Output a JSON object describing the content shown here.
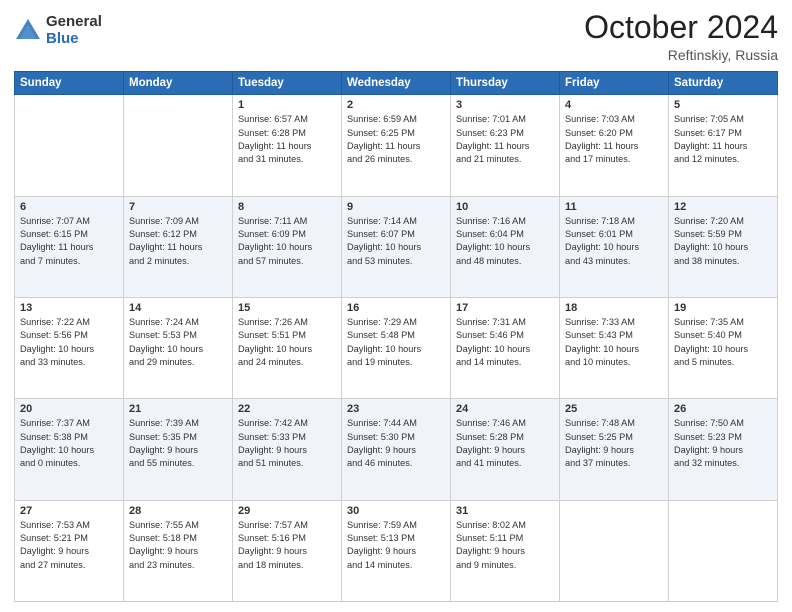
{
  "logo": {
    "general": "General",
    "blue": "Blue"
  },
  "header": {
    "month": "October 2024",
    "location": "Reftinskiy, Russia"
  },
  "days": [
    "Sunday",
    "Monday",
    "Tuesday",
    "Wednesday",
    "Thursday",
    "Friday",
    "Saturday"
  ],
  "rows": [
    [
      {
        "num": "",
        "lines": []
      },
      {
        "num": "",
        "lines": []
      },
      {
        "num": "1",
        "lines": [
          "Sunrise: 6:57 AM",
          "Sunset: 6:28 PM",
          "Daylight: 11 hours",
          "and 31 minutes."
        ]
      },
      {
        "num": "2",
        "lines": [
          "Sunrise: 6:59 AM",
          "Sunset: 6:25 PM",
          "Daylight: 11 hours",
          "and 26 minutes."
        ]
      },
      {
        "num": "3",
        "lines": [
          "Sunrise: 7:01 AM",
          "Sunset: 6:23 PM",
          "Daylight: 11 hours",
          "and 21 minutes."
        ]
      },
      {
        "num": "4",
        "lines": [
          "Sunrise: 7:03 AM",
          "Sunset: 6:20 PM",
          "Daylight: 11 hours",
          "and 17 minutes."
        ]
      },
      {
        "num": "5",
        "lines": [
          "Sunrise: 7:05 AM",
          "Sunset: 6:17 PM",
          "Daylight: 11 hours",
          "and 12 minutes."
        ]
      }
    ],
    [
      {
        "num": "6",
        "lines": [
          "Sunrise: 7:07 AM",
          "Sunset: 6:15 PM",
          "Daylight: 11 hours",
          "and 7 minutes."
        ]
      },
      {
        "num": "7",
        "lines": [
          "Sunrise: 7:09 AM",
          "Sunset: 6:12 PM",
          "Daylight: 11 hours",
          "and 2 minutes."
        ]
      },
      {
        "num": "8",
        "lines": [
          "Sunrise: 7:11 AM",
          "Sunset: 6:09 PM",
          "Daylight: 10 hours",
          "and 57 minutes."
        ]
      },
      {
        "num": "9",
        "lines": [
          "Sunrise: 7:14 AM",
          "Sunset: 6:07 PM",
          "Daylight: 10 hours",
          "and 53 minutes."
        ]
      },
      {
        "num": "10",
        "lines": [
          "Sunrise: 7:16 AM",
          "Sunset: 6:04 PM",
          "Daylight: 10 hours",
          "and 48 minutes."
        ]
      },
      {
        "num": "11",
        "lines": [
          "Sunrise: 7:18 AM",
          "Sunset: 6:01 PM",
          "Daylight: 10 hours",
          "and 43 minutes."
        ]
      },
      {
        "num": "12",
        "lines": [
          "Sunrise: 7:20 AM",
          "Sunset: 5:59 PM",
          "Daylight: 10 hours",
          "and 38 minutes."
        ]
      }
    ],
    [
      {
        "num": "13",
        "lines": [
          "Sunrise: 7:22 AM",
          "Sunset: 5:56 PM",
          "Daylight: 10 hours",
          "and 33 minutes."
        ]
      },
      {
        "num": "14",
        "lines": [
          "Sunrise: 7:24 AM",
          "Sunset: 5:53 PM",
          "Daylight: 10 hours",
          "and 29 minutes."
        ]
      },
      {
        "num": "15",
        "lines": [
          "Sunrise: 7:26 AM",
          "Sunset: 5:51 PM",
          "Daylight: 10 hours",
          "and 24 minutes."
        ]
      },
      {
        "num": "16",
        "lines": [
          "Sunrise: 7:29 AM",
          "Sunset: 5:48 PM",
          "Daylight: 10 hours",
          "and 19 minutes."
        ]
      },
      {
        "num": "17",
        "lines": [
          "Sunrise: 7:31 AM",
          "Sunset: 5:46 PM",
          "Daylight: 10 hours",
          "and 14 minutes."
        ]
      },
      {
        "num": "18",
        "lines": [
          "Sunrise: 7:33 AM",
          "Sunset: 5:43 PM",
          "Daylight: 10 hours",
          "and 10 minutes."
        ]
      },
      {
        "num": "19",
        "lines": [
          "Sunrise: 7:35 AM",
          "Sunset: 5:40 PM",
          "Daylight: 10 hours",
          "and 5 minutes."
        ]
      }
    ],
    [
      {
        "num": "20",
        "lines": [
          "Sunrise: 7:37 AM",
          "Sunset: 5:38 PM",
          "Daylight: 10 hours",
          "and 0 minutes."
        ]
      },
      {
        "num": "21",
        "lines": [
          "Sunrise: 7:39 AM",
          "Sunset: 5:35 PM",
          "Daylight: 9 hours",
          "and 55 minutes."
        ]
      },
      {
        "num": "22",
        "lines": [
          "Sunrise: 7:42 AM",
          "Sunset: 5:33 PM",
          "Daylight: 9 hours",
          "and 51 minutes."
        ]
      },
      {
        "num": "23",
        "lines": [
          "Sunrise: 7:44 AM",
          "Sunset: 5:30 PM",
          "Daylight: 9 hours",
          "and 46 minutes."
        ]
      },
      {
        "num": "24",
        "lines": [
          "Sunrise: 7:46 AM",
          "Sunset: 5:28 PM",
          "Daylight: 9 hours",
          "and 41 minutes."
        ]
      },
      {
        "num": "25",
        "lines": [
          "Sunrise: 7:48 AM",
          "Sunset: 5:25 PM",
          "Daylight: 9 hours",
          "and 37 minutes."
        ]
      },
      {
        "num": "26",
        "lines": [
          "Sunrise: 7:50 AM",
          "Sunset: 5:23 PM",
          "Daylight: 9 hours",
          "and 32 minutes."
        ]
      }
    ],
    [
      {
        "num": "27",
        "lines": [
          "Sunrise: 7:53 AM",
          "Sunset: 5:21 PM",
          "Daylight: 9 hours",
          "and 27 minutes."
        ]
      },
      {
        "num": "28",
        "lines": [
          "Sunrise: 7:55 AM",
          "Sunset: 5:18 PM",
          "Daylight: 9 hours",
          "and 23 minutes."
        ]
      },
      {
        "num": "29",
        "lines": [
          "Sunrise: 7:57 AM",
          "Sunset: 5:16 PM",
          "Daylight: 9 hours",
          "and 18 minutes."
        ]
      },
      {
        "num": "30",
        "lines": [
          "Sunrise: 7:59 AM",
          "Sunset: 5:13 PM",
          "Daylight: 9 hours",
          "and 14 minutes."
        ]
      },
      {
        "num": "31",
        "lines": [
          "Sunrise: 8:02 AM",
          "Sunset: 5:11 PM",
          "Daylight: 9 hours",
          "and 9 minutes."
        ]
      },
      {
        "num": "",
        "lines": []
      },
      {
        "num": "",
        "lines": []
      }
    ]
  ]
}
